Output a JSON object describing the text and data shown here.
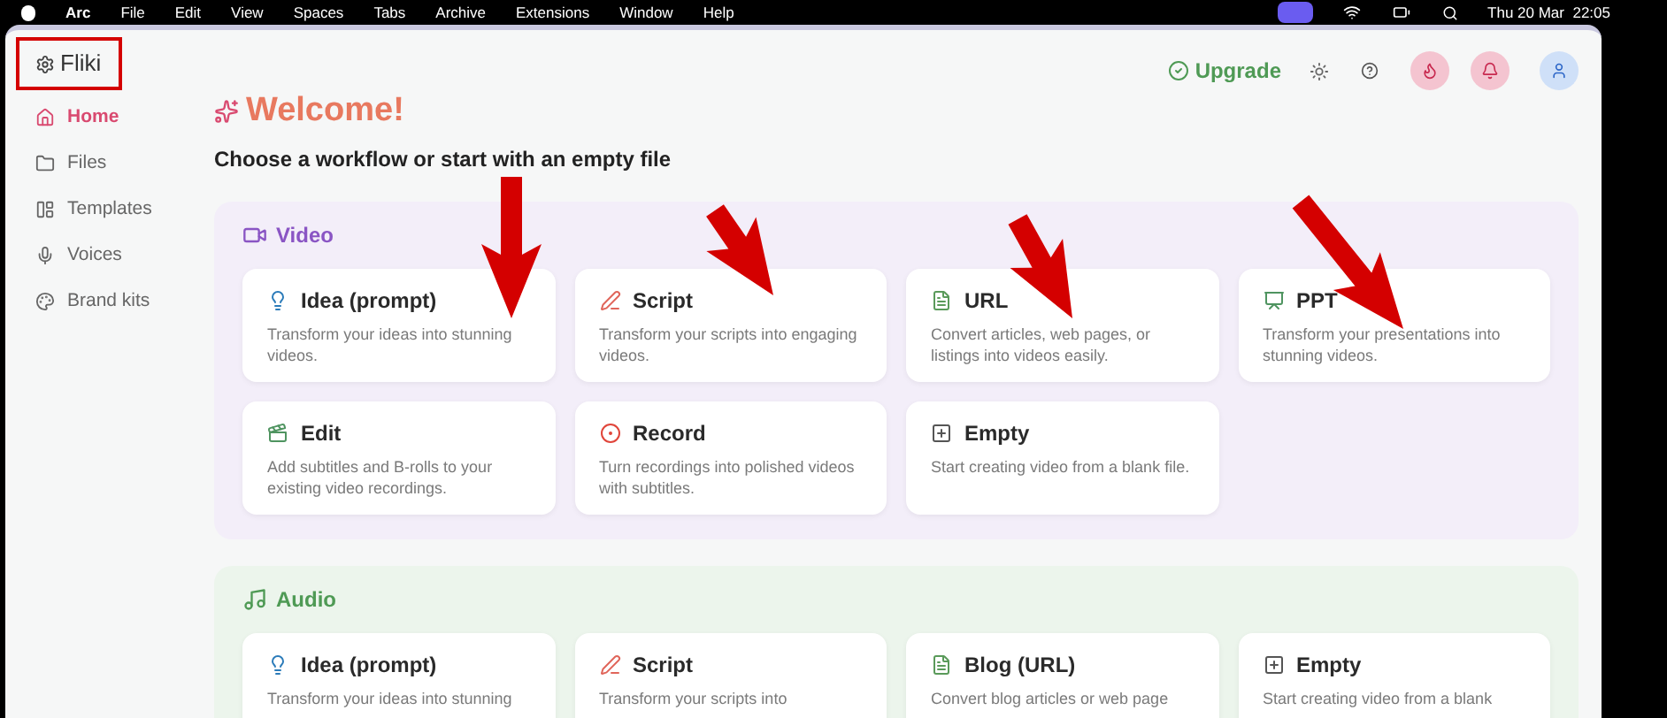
{
  "menu_bar": {
    "app": "Arc",
    "items": [
      "File",
      "Edit",
      "View",
      "Spaces",
      "Tabs",
      "Archive",
      "Extensions",
      "Window",
      "Help"
    ],
    "clock": "Thu 20 Mar  22:05"
  },
  "logo": "Fliki",
  "sidebar": {
    "items": [
      {
        "label": "Home",
        "selected": true
      },
      {
        "label": "Files",
        "selected": false
      },
      {
        "label": "Templates",
        "selected": false
      },
      {
        "label": "Voices",
        "selected": false
      },
      {
        "label": "Brand kits",
        "selected": false
      }
    ]
  },
  "header": {
    "upgrade": "Upgrade"
  },
  "welcome": {
    "title": "Welcome!",
    "subtitle": "Choose a workflow or start with an empty file"
  },
  "sections": [
    {
      "title": "Video",
      "kind": "video",
      "cards": [
        {
          "title": "Idea (prompt)",
          "description": "Transform your ideas into stunning videos."
        },
        {
          "title": "Script",
          "description": "Transform your scripts into engaging videos."
        },
        {
          "title": "URL",
          "description": "Convert articles, web pages, or listings into videos easily."
        },
        {
          "title": "PPT",
          "description": "Transform your presentations into stunning videos."
        },
        {
          "title": "Edit",
          "description": "Add subtitles and B-rolls to your existing video recordings."
        },
        {
          "title": "Record",
          "description": "Turn recordings into polished videos with subtitles."
        },
        {
          "title": "Empty",
          "description": "Start creating video from a blank file."
        }
      ]
    },
    {
      "title": "Audio",
      "kind": "audio",
      "cards": [
        {
          "title": "Idea (prompt)",
          "description": "Transform your ideas into stunning"
        },
        {
          "title": "Script",
          "description": "Transform your scripts into"
        },
        {
          "title": "Blog (URL)",
          "description": "Convert blog articles or web page"
        },
        {
          "title": "Empty",
          "description": "Start creating video from a blank"
        }
      ]
    }
  ]
}
